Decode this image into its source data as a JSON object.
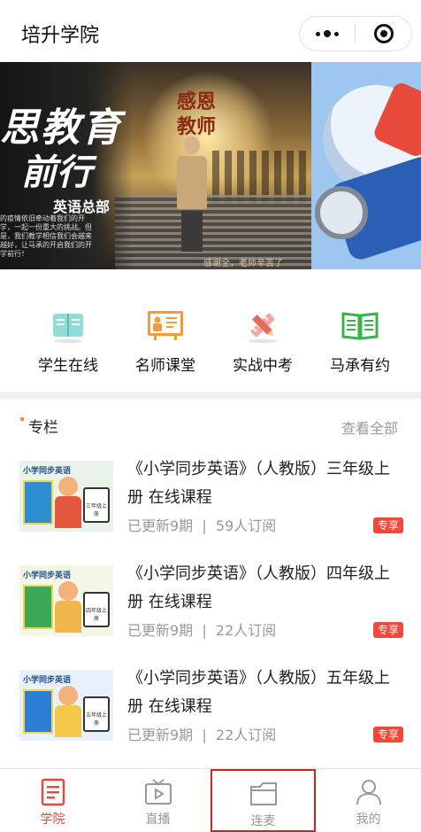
{
  "header": {
    "title": "培升学院"
  },
  "banner": {
    "slide_left": {
      "headline_1": "思教育",
      "headline_2": "前行",
      "sub": "英语总部",
      "small_text": "的疫情依旧牵动着我们的开学，一起一份重大的挑战。但是，我们教学相信我们会越来越好，让马承的开启我们的开学前行！",
      "center_title_1": "感恩",
      "center_title_2": "教师",
      "footer_text": "感谢全，老师辛苦了"
    },
    "active_slide": 1,
    "slide_count": 2
  },
  "quick_nav": [
    {
      "label": "学生在线",
      "icon": "book-open-icon"
    },
    {
      "label": "名师课堂",
      "icon": "teacher-board-icon"
    },
    {
      "label": "实战中考",
      "icon": "pencil-ruler-icon"
    },
    {
      "label": "马承有约",
      "icon": "open-book-green-icon"
    }
  ],
  "section": {
    "title": "专栏",
    "view_all": "查看全部"
  },
  "courses": [
    {
      "thumb_title": "小学同步英语",
      "thumb_tablet": "三年级上册",
      "title": "《小学同步英语》（人教版）三年级上册 在线课程",
      "updated": "已更新9期",
      "subscribers": "59人订阅",
      "badge": "专享"
    },
    {
      "thumb_title": "小学同步英语",
      "thumb_tablet": "四年级上册",
      "title": "《小学同步英语》（人教版）四年级上册 在线课程",
      "updated": "已更新9期",
      "subscribers": "22人订阅",
      "badge": "专享"
    },
    {
      "thumb_title": "小学同步英语",
      "thumb_tablet": "五年级上册",
      "title": "《小学同步英语》（人教版）五年级上册 在线课程",
      "updated": "已更新9期",
      "subscribers": "22人订阅",
      "badge": "专享"
    }
  ],
  "meta_separator": "|",
  "tabbar": [
    {
      "label": "学院",
      "icon": "document-icon",
      "active": true
    },
    {
      "label": "直播",
      "icon": "tv-icon",
      "active": false
    },
    {
      "label": "连麦",
      "icon": "folder-icon",
      "active": false,
      "highlighted": true
    },
    {
      "label": "我的",
      "icon": "user-icon",
      "active": false
    }
  ],
  "colors": {
    "accent": "#e04a3c",
    "badge": "#f0483a",
    "section_mark": "#f08a2a",
    "highlight_box": "#d8201c"
  }
}
